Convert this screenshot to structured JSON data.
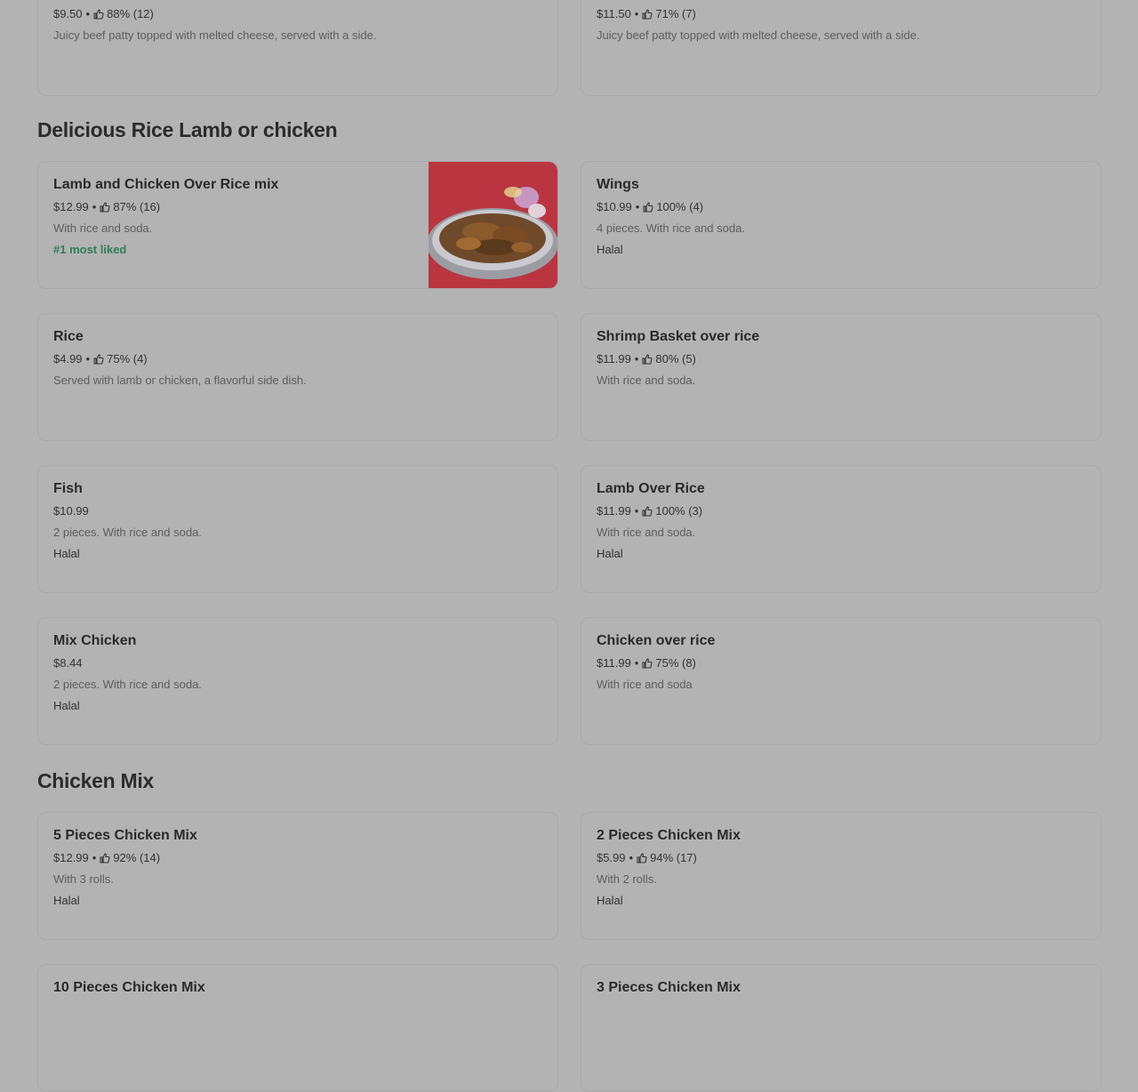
{
  "sections": {
    "rice": {
      "title": "Delicious Rice Lamb or chicken"
    },
    "chicken_mix": {
      "title": "Chicken Mix"
    }
  },
  "cards": {
    "top_left": {
      "price": "$9.50",
      "rating": "88% (12)",
      "desc": "Juicy beef patty topped with melted cheese, served with a side."
    },
    "top_right": {
      "price": "$11.50",
      "rating": "71% (7)",
      "desc": "Juicy beef patty topped with melted cheese, served with a side."
    },
    "lamb_chicken_mix": {
      "title": "Lamb and Chicken Over Rice mix",
      "price": "$12.99",
      "rating": "87% (16)",
      "desc": "With rice and soda.",
      "badge": "#1 most liked"
    },
    "wings": {
      "title": "Wings",
      "price": "$10.99",
      "rating": "100% (4)",
      "desc": "4 pieces. With rice and soda.",
      "tag": "Halal"
    },
    "rice": {
      "title": "Rice",
      "price": "$4.99",
      "rating": "75% (4)",
      "desc": "Served with lamb or chicken, a flavorful side dish."
    },
    "shrimp": {
      "title": "Shrimp Basket over rice",
      "price": "$11.99",
      "rating": "80% (5)",
      "desc": "With rice and soda."
    },
    "fish": {
      "title": "Fish",
      "price": "$10.99",
      "desc": "2 pieces. With rice and soda.",
      "tag": "Halal"
    },
    "lamb_over_rice": {
      "title": "Lamb Over Rice",
      "price": "$11.99",
      "rating": "100% (3)",
      "desc": "With rice and soda.",
      "tag": "Halal"
    },
    "mix_chicken": {
      "title": "Mix Chicken",
      "price": "$8.44",
      "desc": "2 pieces. With rice and soda.",
      "tag": "Halal"
    },
    "chicken_over_rice": {
      "title": "Chicken over rice",
      "price": "$11.99",
      "rating": "75% (8)",
      "desc": "With rice and soda"
    },
    "five_pc": {
      "title": "5 Pieces Chicken Mix",
      "price": "$12.99",
      "rating": "92% (14)",
      "desc": "With 3 rolls.",
      "tag": "Halal"
    },
    "two_pc": {
      "title": "2 Pieces Chicken Mix",
      "price": "$5.99",
      "rating": "94% (17)",
      "desc": "With 2 rolls.",
      "tag": "Halal"
    },
    "ten_pc": {
      "title": "10 Pieces Chicken Mix"
    },
    "three_pc": {
      "title": "3 Pieces Chicken Mix"
    }
  },
  "separator": "•",
  "icons": {
    "thumb": "thumbs-up-icon",
    "dish_image": "lamb-chicken-rice-photo"
  },
  "colors": {
    "overlay": "#b3b3b3",
    "badge": "#2e7d57"
  }
}
